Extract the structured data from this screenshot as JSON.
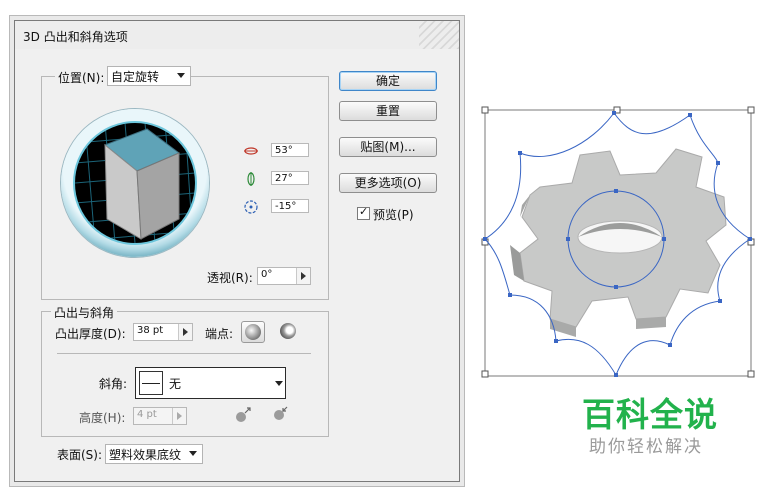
{
  "dialog": {
    "title": "3D 凸出和斜角选项",
    "position": {
      "label": "位置(N):",
      "value": "自定旋转"
    },
    "rotation": {
      "x": "53°",
      "y": "27°",
      "z": "-15°"
    },
    "perspective": {
      "label": "透视(R):",
      "value": "0°"
    },
    "extrude_group": {
      "legend": "凸出与斜角",
      "depth_label": "凸出厚度(D):",
      "depth_value": "38 pt",
      "cap_label": "端点:",
      "bevel_label": "斜角:",
      "bevel_value": "无",
      "height_label": "高度(H):",
      "height_value": "4 pt"
    },
    "surface": {
      "label": "表面(S):",
      "value": "塑料效果底纹"
    },
    "buttons": {
      "ok": "确定",
      "reset": "重置",
      "map": "贴图(M)...",
      "more_options": "更多选项(O)"
    },
    "preview": {
      "label": "预览(P)",
      "checked": true
    }
  },
  "watermark": {
    "main": "百科全说",
    "sub": "助你轻松解决"
  },
  "colors": {
    "cube_top": "#5fa3b7",
    "watermark_green": "#22b24c",
    "selection_blue": "#3a66c4",
    "gear_gray": "#c8c9c8"
  }
}
